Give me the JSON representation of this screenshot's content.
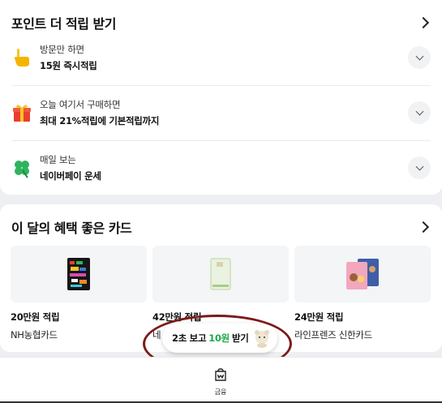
{
  "points_section": {
    "title": "포인트 더 적립 받기",
    "items": [
      {
        "icon": "pointing-hand-icon",
        "sub": "방문만 하면",
        "main": "15원 즉시적립"
      },
      {
        "icon": "gift-icon",
        "sub": "오늘 여기서 구매하면",
        "main": "최대 21%적립에 기본적립까지"
      },
      {
        "icon": "four-leaf-clover-icon",
        "sub": "매일 보는",
        "main": "네이버페이 운세"
      }
    ]
  },
  "cards_section": {
    "title": "이 달의 혜택 좋은 카드",
    "cards": [
      {
        "reward": "20만원 적립",
        "name": "NH농협카드"
      },
      {
        "reward": "42만원 적립",
        "name": "네"
      },
      {
        "reward": "24만원 적립",
        "name": "라인프렌즈 신한카드"
      }
    ]
  },
  "popup": {
    "prefix": "2초 보고 ",
    "highlight": "10원",
    "suffix": " 받기",
    "highlight_color": "#1fa84b"
  },
  "bottom_nav": {
    "tab_label": "금융",
    "icon": "wallet-won-icon"
  }
}
